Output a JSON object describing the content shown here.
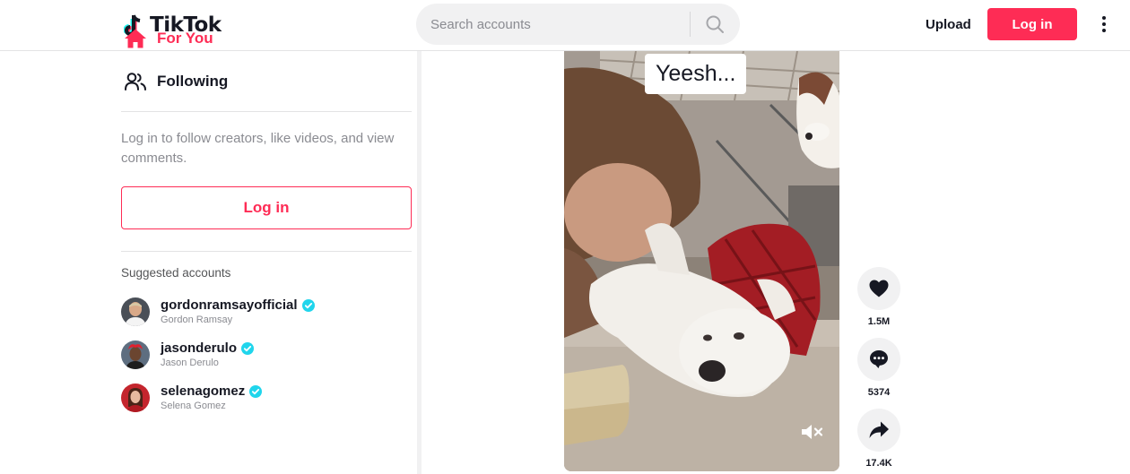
{
  "header": {
    "logo_text": "TikTok",
    "search_placeholder": "Search accounts",
    "upload_label": "Upload",
    "login_label": "Log in"
  },
  "sidebar": {
    "nav": [
      {
        "label": "For You",
        "icon": "home-icon",
        "active": true
      },
      {
        "label": "Following",
        "icon": "following-icon",
        "active": false
      }
    ],
    "login_prompt": "Log in to follow creators, like videos, and view comments.",
    "login_label": "Log in",
    "suggested_title": "Suggested accounts",
    "accounts": [
      {
        "username": "gordonramsayofficial",
        "name": "Gordon Ramsay",
        "verified": true
      },
      {
        "username": "jasonderulo",
        "name": "Jason Derulo",
        "verified": true
      },
      {
        "username": "selenagomez",
        "name": "Selena Gomez",
        "verified": true
      }
    ]
  },
  "video": {
    "caption": "Yeesh..."
  },
  "actions": {
    "likes": "1.5M",
    "comments": "5374",
    "shares": "17.4K"
  },
  "colors": {
    "brand": "#fe2c55",
    "verified": "#20d5ec",
    "text": "#161823"
  }
}
